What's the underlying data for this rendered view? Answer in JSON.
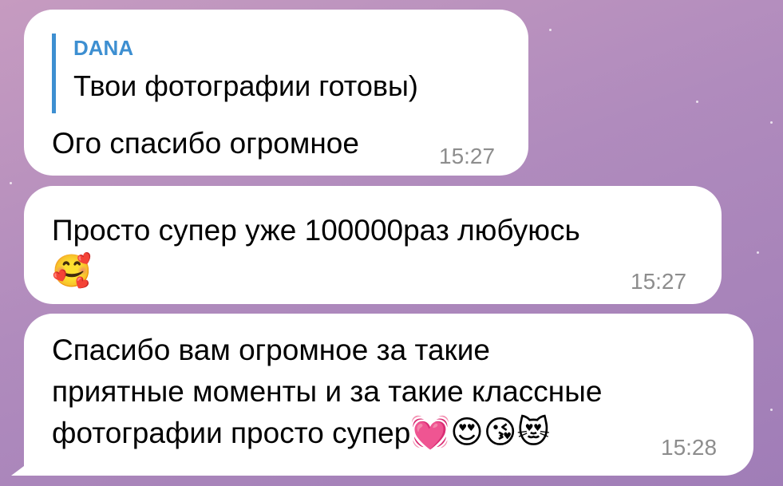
{
  "chat": {
    "messages": [
      {
        "reply": {
          "author": "DANA",
          "text": "Твои фотографии готовы)"
        },
        "text": "Ого спасибо огромное",
        "time": "15:27"
      },
      {
        "text": "Просто супер уже 100000раз любуюсь",
        "emoji": "🥰",
        "time": "15:27"
      },
      {
        "text": "Спасибо вам огромное за такие\nприятные моменты и за такие классные\nфотографии просто супер",
        "emoji": "💓😍😘😻",
        "time": "15:28"
      }
    ]
  },
  "colors": {
    "reply_accent": "#3d8fd1",
    "bubble_bg": "#ffffff",
    "time_text": "#8d8d8d",
    "wallpaper": "#b08bbd"
  }
}
